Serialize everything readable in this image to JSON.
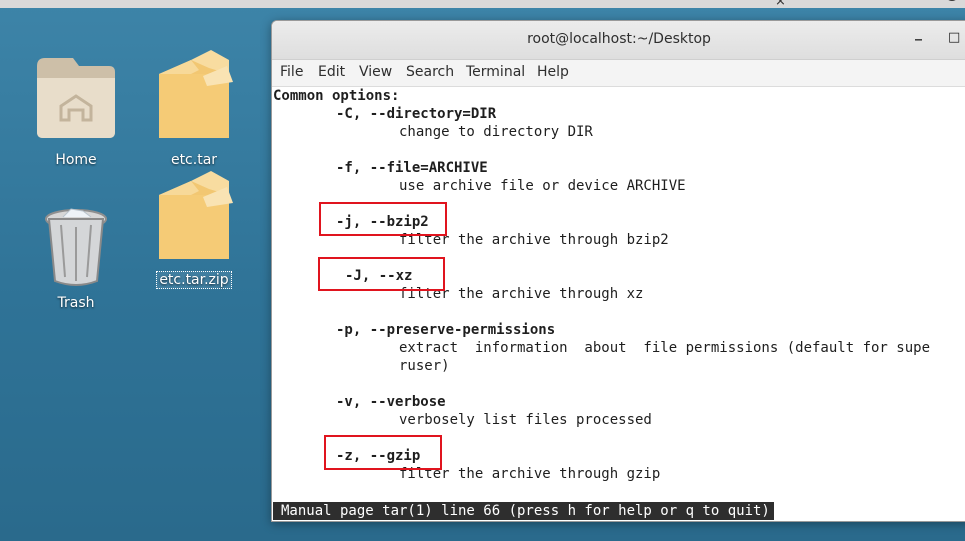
{
  "desktop": {
    "icons": [
      {
        "label": "Home"
      },
      {
        "label": "etc.tar"
      },
      {
        "label": "Trash"
      },
      {
        "label": "etc.tar.zip"
      }
    ]
  },
  "topbar": {
    "close_glyph": "×"
  },
  "terminal": {
    "title": "root@localhost:~/Desktop",
    "minimize": "_",
    "maximize": "□",
    "menu": [
      "File",
      "Edit",
      "View",
      "Search",
      "Terminal",
      "Help"
    ],
    "lines": {
      "heading": "Common options:",
      "opt_C": "-C, --directory=DIR",
      "desc_C": "change to directory DIR",
      "opt_f": "-f, --file=ARCHIVE",
      "desc_f": "use archive file or device ARCHIVE",
      "opt_j": "-j, --bzip2",
      "desc_j": "filter the archive through bzip2",
      "opt_J": "-J, --xz",
      "desc_J": "filter the archive through xz",
      "opt_p": "-p, --preserve-permissions",
      "desc_p1": "extract  information  about  file permissions (default for supe",
      "desc_p2": "ruser)",
      "opt_v": "-v, --verbose",
      "desc_v": "verbosely list files processed",
      "opt_z": "-z, --gzip",
      "desc_z": "filter the archive through gzip"
    },
    "status": "Manual page tar(1) line 66 (press h for help or q to quit)"
  },
  "colors": {
    "highlight_box": "#e0141e",
    "desktop_bg": "#2f7397",
    "status_bg": "#2e2e2e"
  }
}
